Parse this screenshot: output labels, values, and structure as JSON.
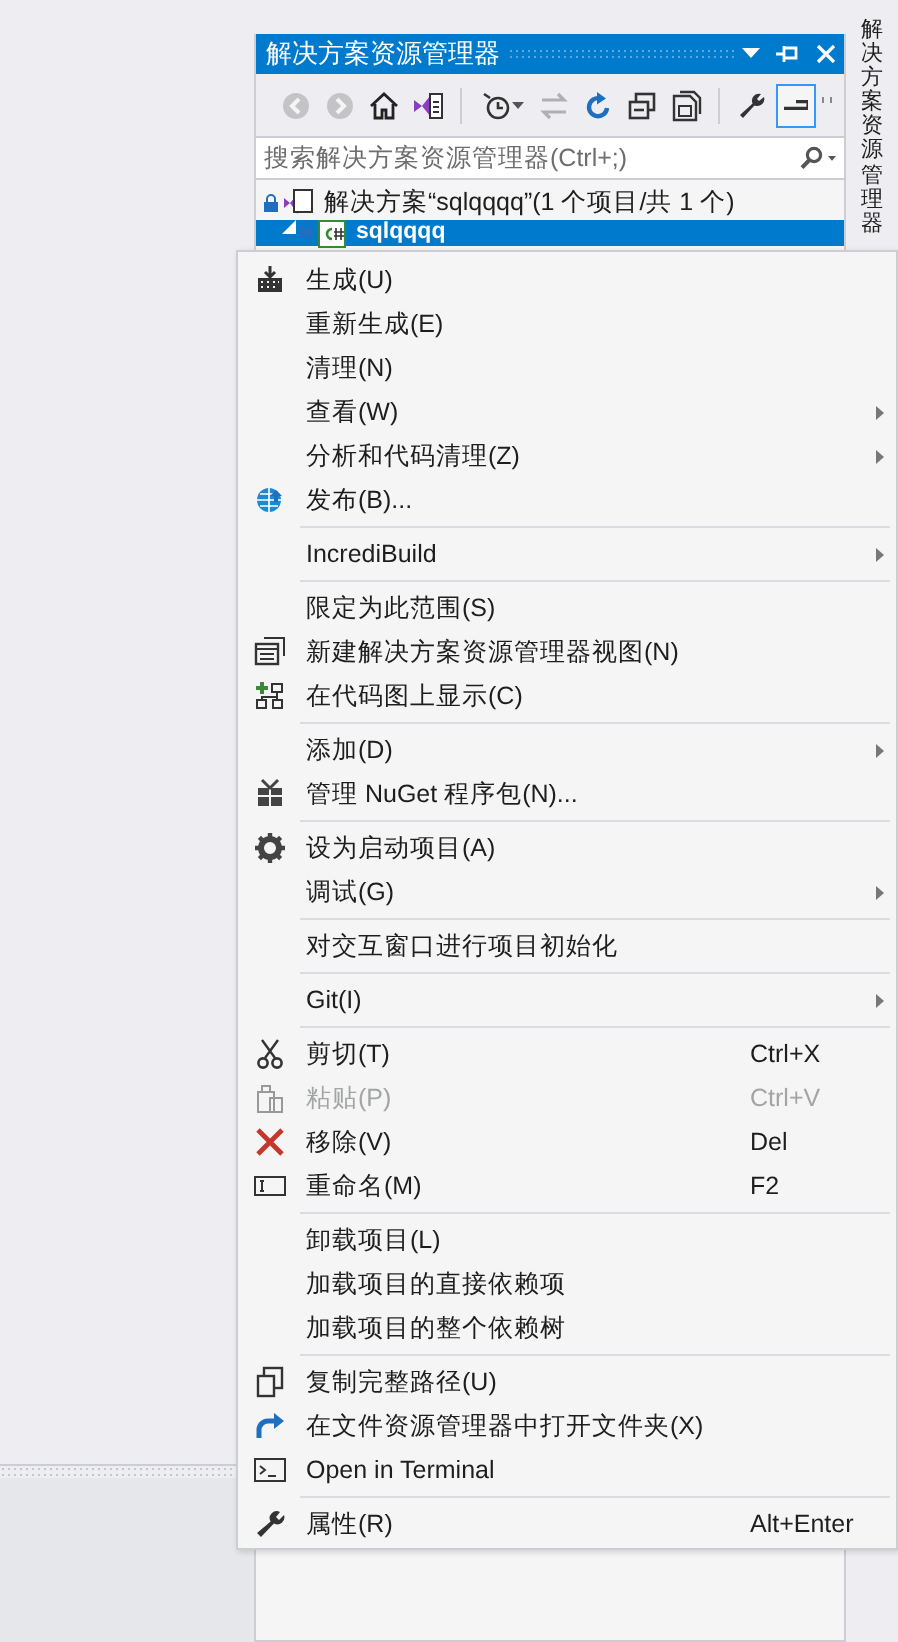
{
  "side_tab": {
    "label": "解决方案资源管理器"
  },
  "panel": {
    "title": "解决方案资源管理器",
    "toolbar": [
      {
        "disabled": true,
        "on": false
      },
      {
        "disabled": true,
        "on": false
      },
      {
        "disabled": false,
        "on": false
      },
      {
        "disabled": false,
        "on": false
      },
      {
        "disabled": false,
        "on": false
      },
      {
        "disabled": true,
        "on": false
      },
      {
        "disabled": false,
        "on": false
      },
      {
        "disabled": false,
        "on": false
      },
      {
        "disabled": false,
        "on": false
      },
      {
        "disabled": false,
        "on": false
      },
      {
        "disabled": false,
        "on": true
      }
    ],
    "search": {
      "placeholder": "搜索解决方案资源管理器(Ctrl+;)"
    },
    "tree": [
      {
        "label": "解决方案“sqlqqqq”(1 个项目/共 1 个)",
        "selected": false,
        "children": [
          {
            "label": "sqlqqqq",
            "selected": true,
            "expanded": true
          }
        ]
      }
    ]
  },
  "context_menu": {
    "items": [
      {
        "kind": "item",
        "label": "生成(U)",
        "disabled": false,
        "submenu": false
      },
      {
        "kind": "item",
        "label": "重新生成(E)",
        "disabled": false,
        "submenu": false
      },
      {
        "kind": "item",
        "label": "清理(N)",
        "disabled": false,
        "submenu": false
      },
      {
        "kind": "item",
        "label": "查看(W)",
        "disabled": false,
        "submenu": true
      },
      {
        "kind": "item",
        "label": "分析和代码清理(Z)",
        "disabled": false,
        "submenu": true
      },
      {
        "kind": "item",
        "label": "发布(B)...",
        "disabled": false,
        "submenu": false
      },
      {
        "kind": "separator"
      },
      {
        "kind": "item",
        "label": "IncrediBuild",
        "disabled": false,
        "submenu": true
      },
      {
        "kind": "separator"
      },
      {
        "kind": "item",
        "label": "限定为此范围(S)",
        "disabled": false,
        "submenu": false
      },
      {
        "kind": "item",
        "label": "新建解决方案资源管理器视图(N)",
        "disabled": false,
        "submenu": false
      },
      {
        "kind": "item",
        "label": "在代码图上显示(C)",
        "disabled": false,
        "submenu": false
      },
      {
        "kind": "separator"
      },
      {
        "kind": "item",
        "label": "添加(D)",
        "disabled": false,
        "submenu": true
      },
      {
        "kind": "item",
        "label": "管理 NuGet 程序包(N)...",
        "disabled": false,
        "submenu": false
      },
      {
        "kind": "separator"
      },
      {
        "kind": "item",
        "label": "设为启动项目(A)",
        "disabled": false,
        "submenu": false
      },
      {
        "kind": "item",
        "label": "调试(G)",
        "disabled": false,
        "submenu": true
      },
      {
        "kind": "separator"
      },
      {
        "kind": "item",
        "label": "对交互窗口进行项目初始化",
        "disabled": false,
        "submenu": false
      },
      {
        "kind": "separator"
      },
      {
        "kind": "item",
        "label": "Git(I)",
        "disabled": false,
        "submenu": true
      },
      {
        "kind": "separator"
      },
      {
        "kind": "item",
        "label": "剪切(T)",
        "shortcut": "Ctrl+X",
        "disabled": false,
        "submenu": false
      },
      {
        "kind": "item",
        "label": "粘贴(P)",
        "shortcut": "Ctrl+V",
        "disabled": true,
        "submenu": false
      },
      {
        "kind": "item",
        "label": "移除(V)",
        "shortcut": "Del",
        "disabled": false,
        "submenu": false
      },
      {
        "kind": "item",
        "label": "重命名(M)",
        "shortcut": "F2",
        "disabled": false,
        "submenu": false
      },
      {
        "kind": "separator"
      },
      {
        "kind": "item",
        "label": "卸载项目(L)",
        "disabled": false,
        "submenu": false
      },
      {
        "kind": "item",
        "label": "加载项目的直接依赖项",
        "disabled": false,
        "submenu": false
      },
      {
        "kind": "item",
        "label": "加载项目的整个依赖树",
        "disabled": false,
        "submenu": false
      },
      {
        "kind": "separator"
      },
      {
        "kind": "item",
        "label": "复制完整路径(U)",
        "disabled": false,
        "submenu": false
      },
      {
        "kind": "item",
        "label": "在文件资源管理器中打开文件夹(X)",
        "disabled": false,
        "submenu": false
      },
      {
        "kind": "item",
        "label": "Open in Terminal",
        "disabled": false,
        "submenu": false
      },
      {
        "kind": "separator"
      },
      {
        "kind": "item",
        "label": "属性(R)",
        "shortcut": "Alt+Enter",
        "disabled": false,
        "submenu": false
      }
    ]
  }
}
